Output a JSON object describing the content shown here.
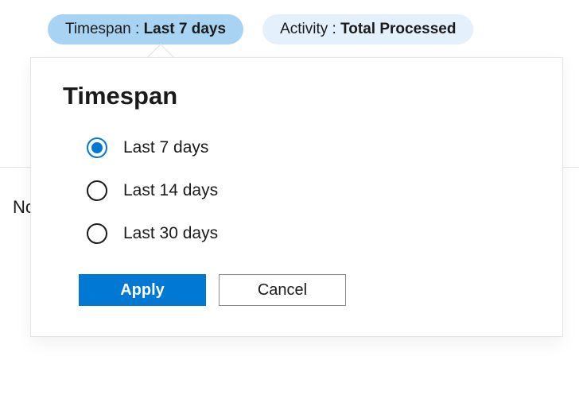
{
  "filters": {
    "timespan": {
      "label": "Timespan : ",
      "value": "Last 7 days"
    },
    "activity": {
      "label": "Activity : ",
      "value": "Total Processed"
    }
  },
  "clipped": {
    "left_text": "No"
  },
  "popover": {
    "title": "Timespan",
    "options": [
      {
        "label": "Last 7 days",
        "selected": true
      },
      {
        "label": "Last 14 days",
        "selected": false
      },
      {
        "label": "Last 30 days",
        "selected": false
      }
    ],
    "buttons": {
      "apply": "Apply",
      "cancel": "Cancel"
    }
  }
}
